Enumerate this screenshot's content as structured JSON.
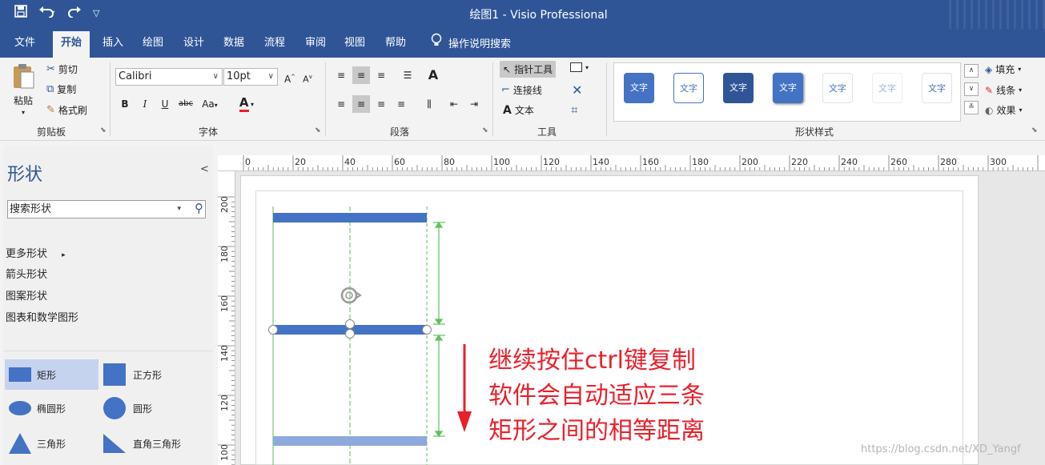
{
  "titlebar": {
    "title": "绘图1  -  Visio Professional",
    "qat": {
      "save_icon": "save-icon",
      "undo_icon": "undo-icon",
      "redo_icon": "redo-icon",
      "customize_icon": "customize-icon"
    }
  },
  "tabs": [
    {
      "label": "文件"
    },
    {
      "label": "开始"
    },
    {
      "label": "插入"
    },
    {
      "label": "绘图"
    },
    {
      "label": "设计"
    },
    {
      "label": "数据"
    },
    {
      "label": "流程"
    },
    {
      "label": "审阅"
    },
    {
      "label": "视图"
    },
    {
      "label": "帮助"
    }
  ],
  "tell_me": "操作说明搜索",
  "ribbon": {
    "clipboard": {
      "label": "剪贴板",
      "paste": "粘贴",
      "cut": "剪切",
      "copy": "复制",
      "format_painter": "格式刷"
    },
    "font": {
      "label": "字体",
      "name": "Calibri",
      "size": "10pt",
      "bold": "B",
      "italic": "I",
      "underline": "U",
      "strike": "abc",
      "case": "Aa",
      "color": "A"
    },
    "paragraph": {
      "label": "段落"
    },
    "tools": {
      "label": "工具",
      "pointer": "指针工具",
      "connector": "连接线",
      "text": "文本"
    },
    "shape_styles": {
      "label": "形状样式",
      "tile_text": "文字",
      "fill": "填充",
      "line": "线条",
      "effects": "效果"
    }
  },
  "shapes_panel": {
    "title": "形状",
    "search_value": "搜索形状",
    "menu": [
      "更多形状",
      "箭头形状",
      "图案形状",
      "图表和数学图形"
    ],
    "stencils": [
      {
        "label": "矩形"
      },
      {
        "label": "正方形"
      },
      {
        "label": "椭圆形"
      },
      {
        "label": "圆形"
      },
      {
        "label": "三角形"
      },
      {
        "label": "直角三角形"
      }
    ]
  },
  "ruler": {
    "h_labels": [
      "0",
      "20",
      "40",
      "60",
      "80",
      "100",
      "120",
      "140",
      "160",
      "180",
      "200",
      "220",
      "240",
      "260",
      "280",
      "300"
    ],
    "v_labels": [
      "200",
      "180",
      "160",
      "140",
      "120",
      "100"
    ]
  },
  "annotation": {
    "line1": "继续按住ctrl键复制",
    "line2": "软件会自动适应三条",
    "line3": "矩形之间的相等距离"
  },
  "watermark": "https://blog.csdn.net/XD_Yangf",
  "colors": {
    "brand": "#2f5597",
    "shape_fill": "#4472c4",
    "guide": "#5ec25e",
    "annotation": "#e8212b"
  }
}
